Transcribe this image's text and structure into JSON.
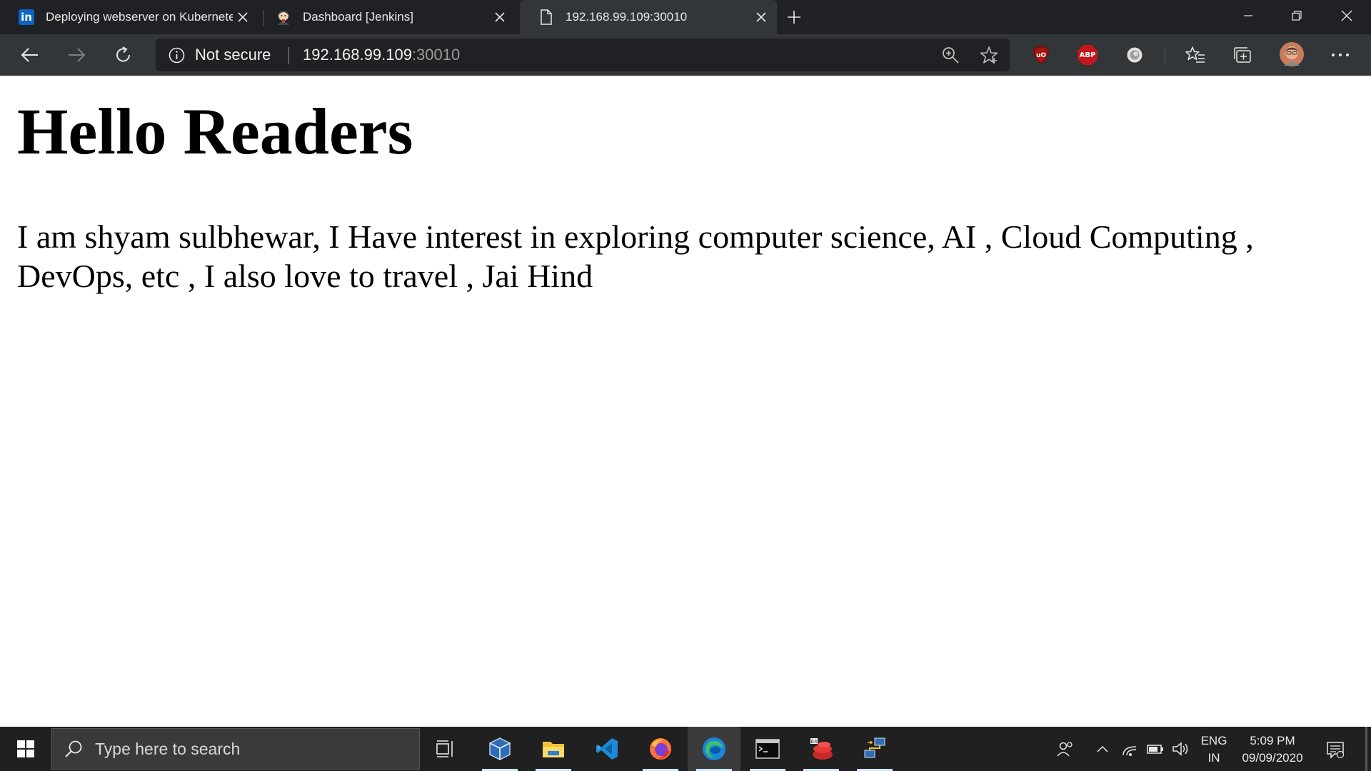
{
  "browser": {
    "tabs": [
      {
        "label": "Deploying webserver on Kubernetes",
        "icon": "linkedin-icon",
        "favicon_text": "in"
      },
      {
        "label": "Dashboard [Jenkins]",
        "icon": "jenkins-icon"
      },
      {
        "label": "192.168.99.109:30010",
        "icon": "page-icon",
        "active": true
      }
    ],
    "address_bar": {
      "security_label": "Not secure",
      "url_host": "192.168.99.109",
      "url_port": ":30010"
    },
    "extensions": [
      {
        "name": "ublock-origin-icon",
        "badge": "uO"
      },
      {
        "name": "adblock-plus-icon",
        "badge": "ABP"
      }
    ]
  },
  "page": {
    "heading": "Hello Readers",
    "paragraph": "I am shyam sulbhewar, I Have interest in exploring computer science, AI , Cloud Computing , DevOps, etc , I also love to travel , Jai Hind"
  },
  "taskbar": {
    "search_placeholder": "Type here to search",
    "language": "ENG",
    "region": "IN",
    "time": "5:09 PM",
    "date": "09/09/2020"
  },
  "colors": {
    "chrome_dark": "#202124",
    "toolbar": "#323639",
    "taskbar": "#202020",
    "linkedin": "#0a66c2",
    "abp_red": "#c4161c"
  }
}
